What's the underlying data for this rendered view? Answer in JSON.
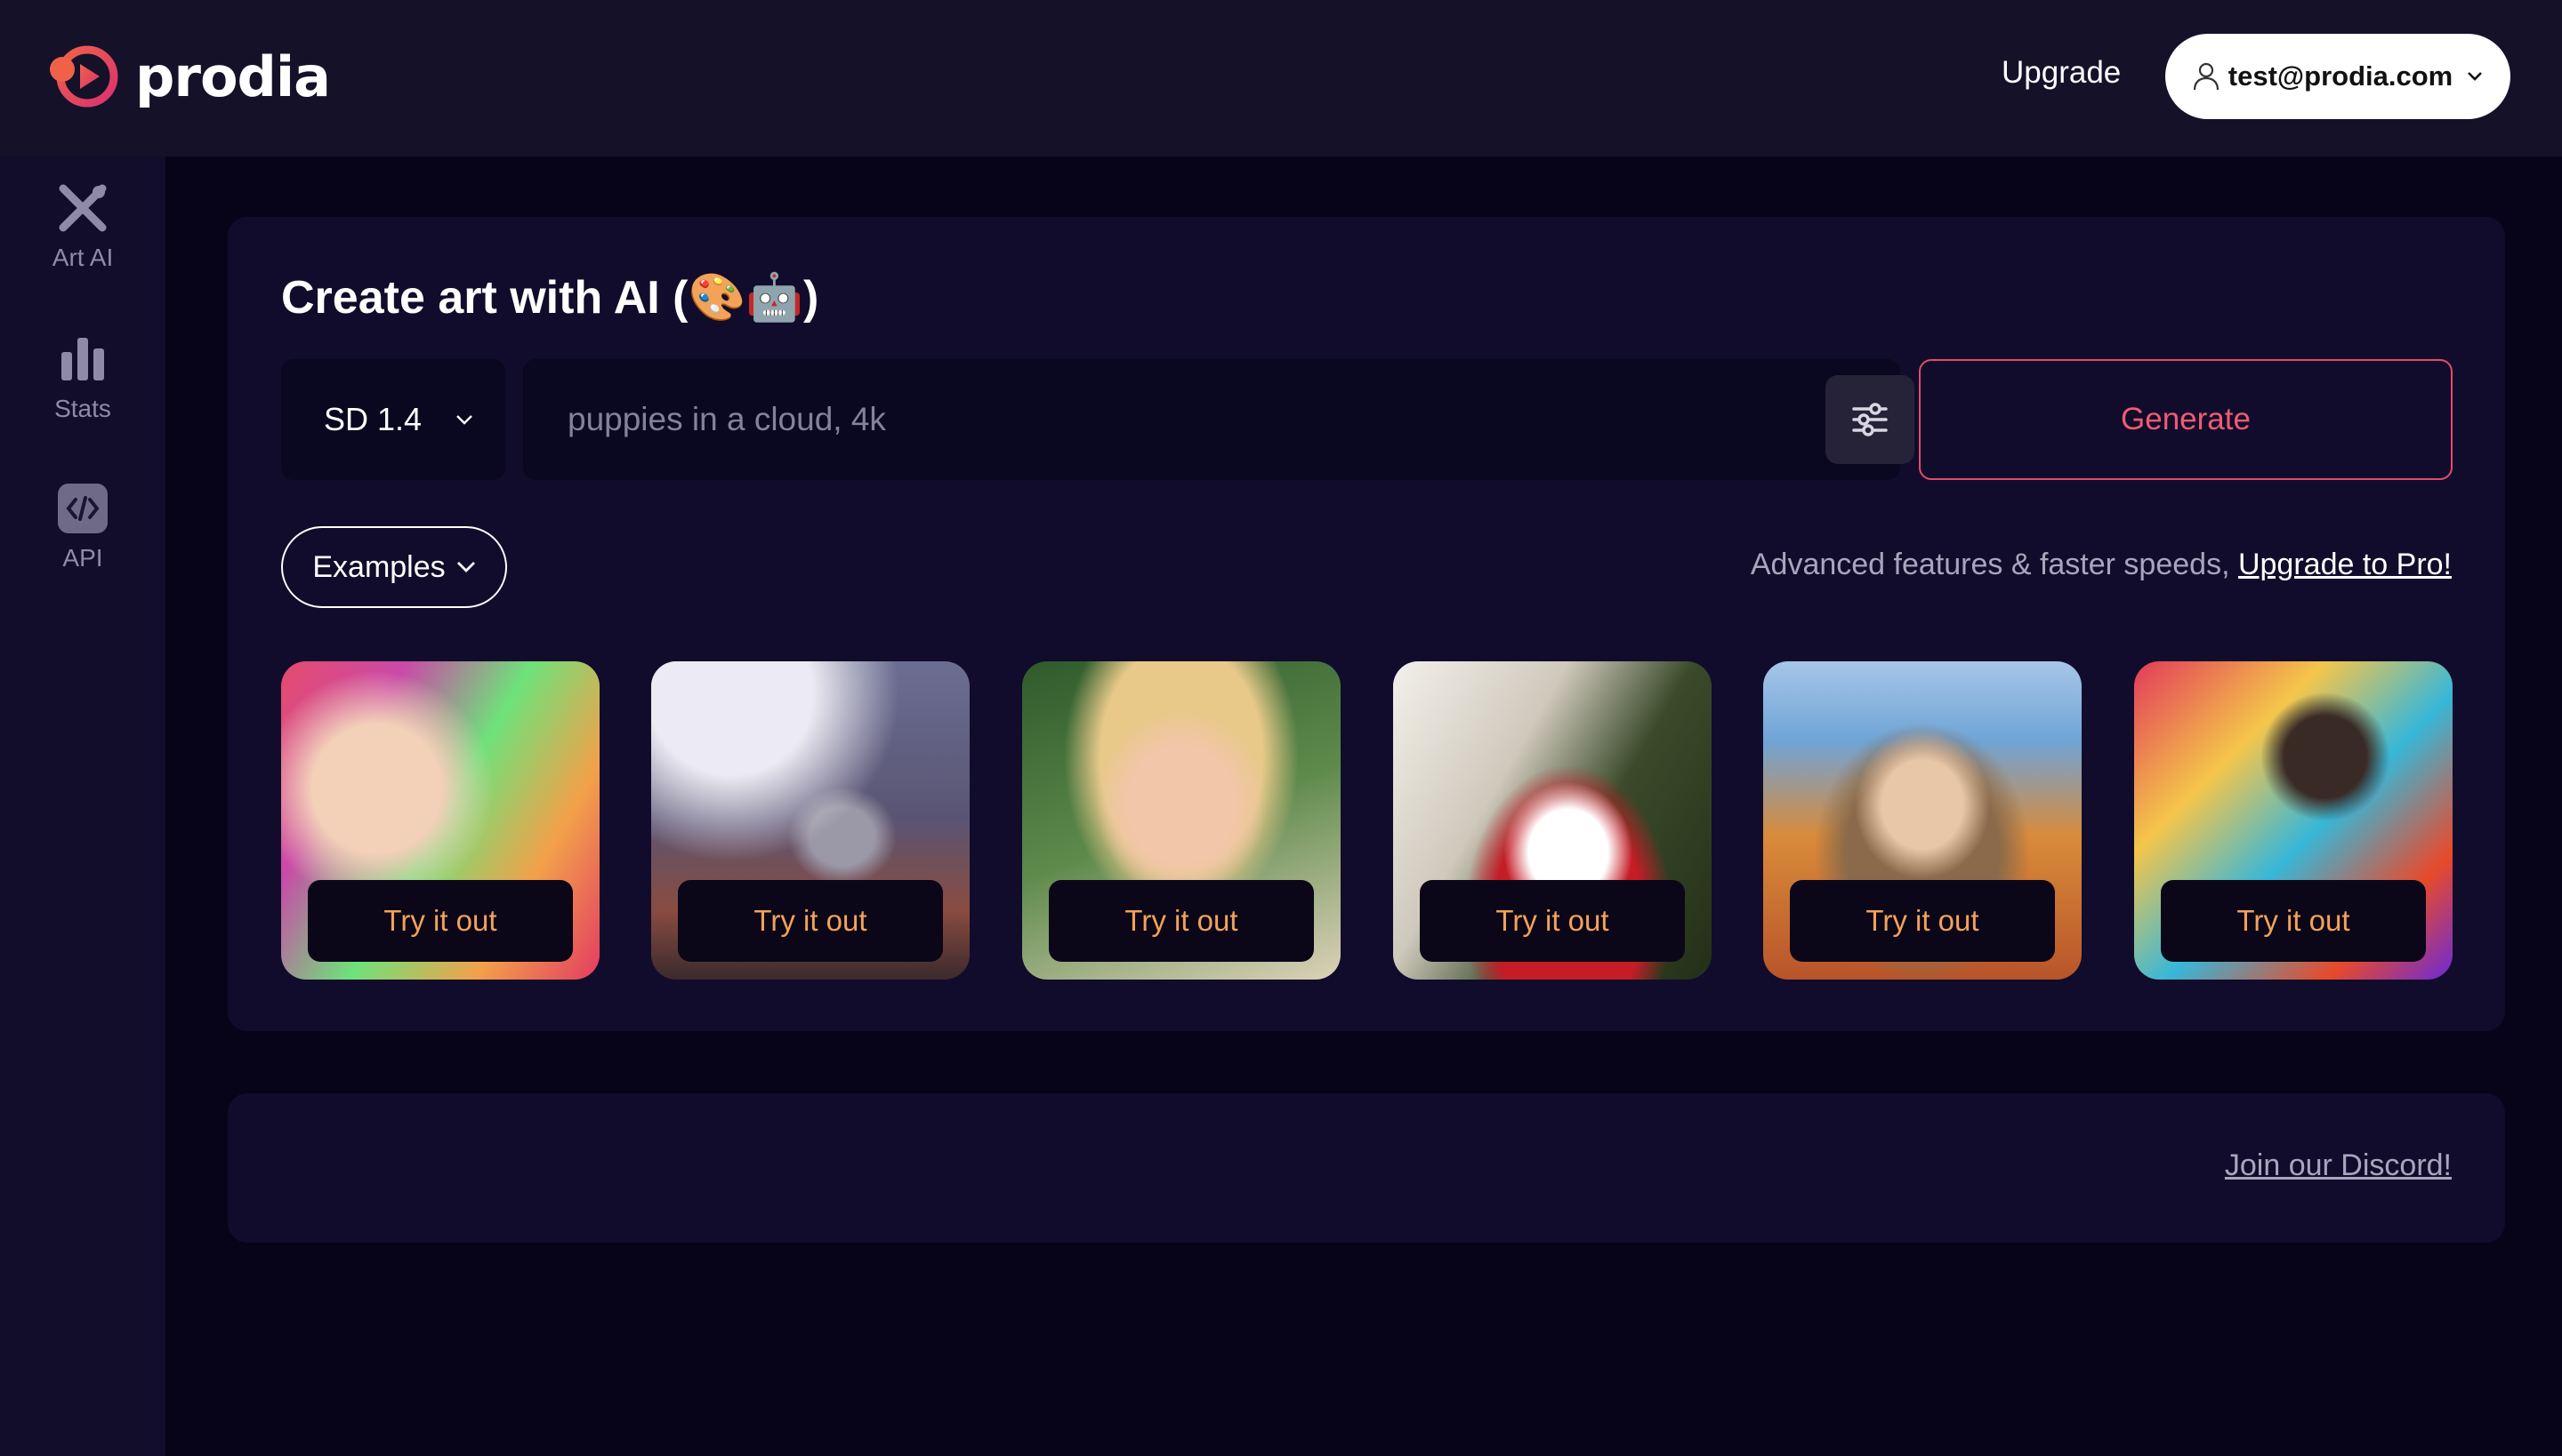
{
  "header": {
    "brand": "prodia",
    "upgrade_label": "Upgrade",
    "account_email": "test@prodia.com"
  },
  "sidebar": {
    "items": [
      {
        "label": "Art AI",
        "icon": "art-ai-icon"
      },
      {
        "label": "Stats",
        "icon": "bar-chart-icon"
      },
      {
        "label": "API",
        "icon": "code-icon"
      }
    ]
  },
  "main": {
    "title": "Create art with AI (🎨🤖)",
    "model": "SD 1.4",
    "prompt_placeholder": "puppies in a cloud, 4k",
    "prompt_value": "",
    "generate_label": "Generate",
    "examples_label": "Examples",
    "promo_text": "Advanced features & faster speeds, ",
    "promo_link": "Upgrade to Pro!",
    "tiles": [
      {
        "label": "Try it out"
      },
      {
        "label": "Try it out"
      },
      {
        "label": "Try it out"
      },
      {
        "label": "Try it out"
      },
      {
        "label": "Try it out"
      },
      {
        "label": "Try it out"
      }
    ]
  },
  "footer": {
    "discord_label": "Join our Discord!"
  },
  "colors": {
    "accent": "#ef5b72",
    "tile_button_text": "#f3a25a",
    "background": "#07041a",
    "card": "#110c2b"
  }
}
